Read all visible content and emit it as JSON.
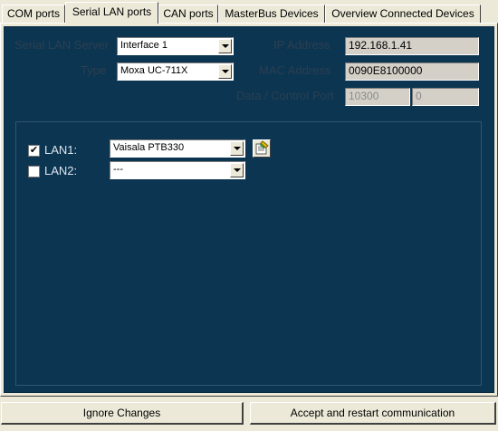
{
  "tabs": [
    {
      "label": "COM ports"
    },
    {
      "label": "Serial LAN ports"
    },
    {
      "label": "CAN ports"
    },
    {
      "label": "MasterBus Devices"
    },
    {
      "label": "Overview Connected Devices"
    }
  ],
  "server": {
    "label": "Serial LAN Server",
    "value": "Interface 1",
    "type_label": "Type",
    "type_value": "Moxa UC-711X"
  },
  "network": {
    "ip_label": "IP Address",
    "ip_value": "192.168.1.41",
    "mac_label": "MAC Address",
    "mac_value": "0090E8100000",
    "port_label": "Data / Control Port",
    "data_port": "10300",
    "control_port": "0"
  },
  "lans": [
    {
      "label": "LAN1:",
      "checked": true,
      "value": "Vaisala PTB330"
    },
    {
      "label": "LAN2:",
      "checked": false,
      "value": "---"
    }
  ],
  "buttons": {
    "ignore": "Ignore Changes",
    "accept": "Accept and restart communication"
  },
  "icons": {
    "settings": "settings-edit-icon",
    "check": "checkmark-icon",
    "dropdown": "chevron-down-icon"
  }
}
